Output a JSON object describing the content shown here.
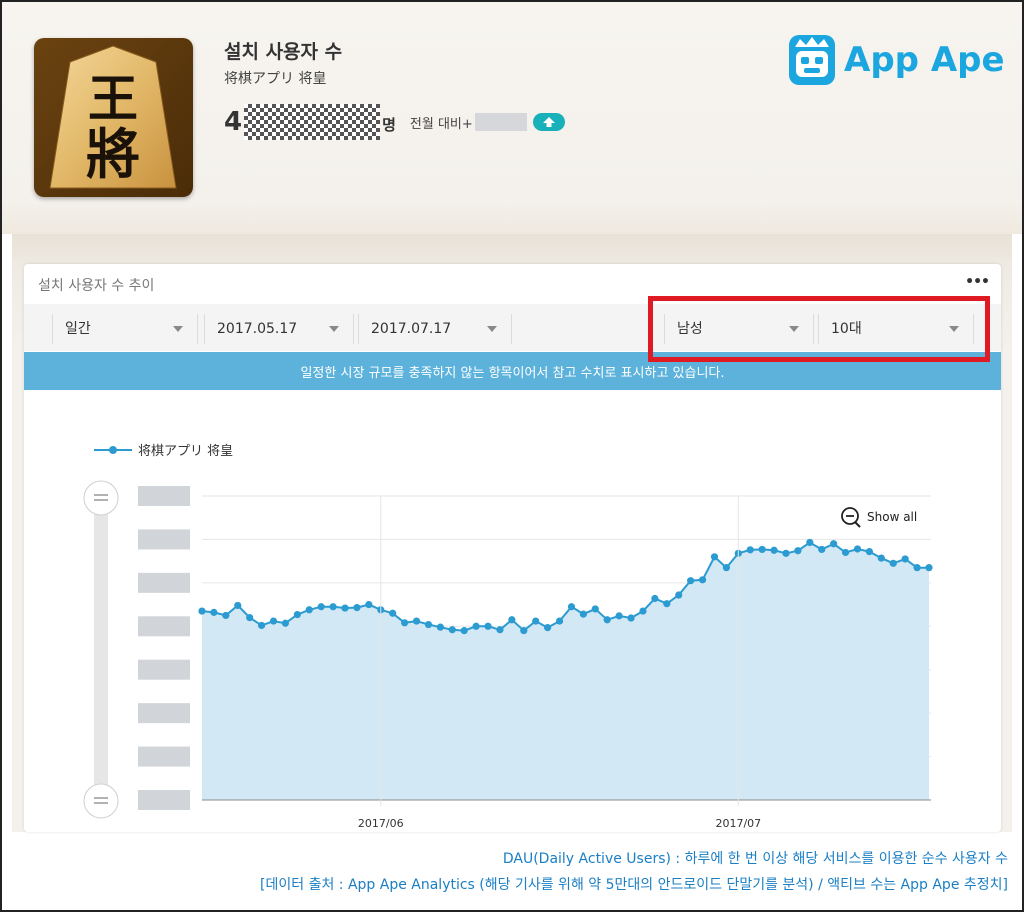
{
  "app": {
    "metric_title": "설치 사용자 수",
    "app_name": "将棋アプリ 将皇",
    "icon_glyph_top": "王",
    "icon_glyph_bottom": "將",
    "metric_value_visible": "4",
    "metric_unit": "명",
    "comparison_label": "전월 대비+"
  },
  "brand": {
    "name": "App Ape"
  },
  "card": {
    "title": "설치 사용자 수 추이",
    "more_label": "•••",
    "filters": {
      "period": "일간",
      "start_date": "2017.05.17",
      "end_date": "2017.07.17",
      "gender": "남성",
      "age": "10대"
    },
    "notice": "일정한 시장 규모를 충족하지 않는 항목이어서 참고 수치로 표시하고 있습니다.",
    "show_all_label": "Show all"
  },
  "colors": {
    "accent": "#5cb2db",
    "line": "#2b9bd1",
    "area": "#d3e8f5",
    "highlight": "#e01a22",
    "brand": "#1ba6e0",
    "up_badge": "#19b1b9"
  },
  "chart_data": {
    "type": "area",
    "series": [
      {
        "name": "将棋アプリ 将皇",
        "x": [
          "2017-05-17",
          "2017-05-18",
          "2017-05-19",
          "2017-05-20",
          "2017-05-21",
          "2017-05-22",
          "2017-05-23",
          "2017-05-24",
          "2017-05-25",
          "2017-05-26",
          "2017-05-27",
          "2017-05-28",
          "2017-05-29",
          "2017-05-30",
          "2017-05-31",
          "2017-06-01",
          "2017-06-02",
          "2017-06-03",
          "2017-06-04",
          "2017-06-05",
          "2017-06-06",
          "2017-06-07",
          "2017-06-08",
          "2017-06-09",
          "2017-06-10",
          "2017-06-11",
          "2017-06-12",
          "2017-06-13",
          "2017-06-14",
          "2017-06-15",
          "2017-06-16",
          "2017-06-17",
          "2017-06-18",
          "2017-06-19",
          "2017-06-20",
          "2017-06-21",
          "2017-06-22",
          "2017-06-23",
          "2017-06-24",
          "2017-06-25",
          "2017-06-26",
          "2017-06-27",
          "2017-06-28",
          "2017-06-29",
          "2017-06-30",
          "2017-07-01",
          "2017-07-02",
          "2017-07-03",
          "2017-07-04",
          "2017-07-05",
          "2017-07-06",
          "2017-07-07",
          "2017-07-08",
          "2017-07-09",
          "2017-07-10",
          "2017-07-11",
          "2017-07-12",
          "2017-07-13",
          "2017-07-14",
          "2017-07-15",
          "2017-07-16",
          "2017-07-17"
        ],
        "values": [
          4.35,
          4.32,
          4.25,
          4.48,
          4.2,
          4.02,
          4.12,
          4.07,
          4.27,
          4.38,
          4.45,
          4.45,
          4.42,
          4.43,
          4.5,
          4.38,
          4.3,
          4.08,
          4.12,
          4.04,
          3.98,
          3.92,
          3.9,
          4.0,
          4.0,
          3.92,
          4.15,
          3.9,
          4.12,
          3.97,
          4.12,
          4.45,
          4.28,
          4.4,
          4.15,
          4.24,
          4.19,
          4.35,
          4.64,
          4.52,
          4.72,
          5.05,
          5.07,
          5.6,
          5.35,
          5.68,
          5.76,
          5.77,
          5.75,
          5.68,
          5.74,
          5.93,
          5.77,
          5.9,
          5.7,
          5.78,
          5.72,
          5.57,
          5.45,
          5.55,
          5.35,
          5.35
        ]
      }
    ],
    "x_ticks": [
      "2017/06",
      "2017/07"
    ],
    "y_tick_labels_hidden": true,
    "ylim": [
      0,
      7
    ],
    "grid": true,
    "legend_position": "top-left"
  },
  "footer": {
    "line1": "DAU(Daily Active Users) : 하루에 한 번 이상 해당 서비스를 이용한 순수 사용자 수",
    "line2": "[데이터 출처 : App Ape Analytics (해당 기사를 위해 약 5만대의 안드로이드 단말기를 분석) / 액티브 수는 App Ape 추정치]"
  }
}
